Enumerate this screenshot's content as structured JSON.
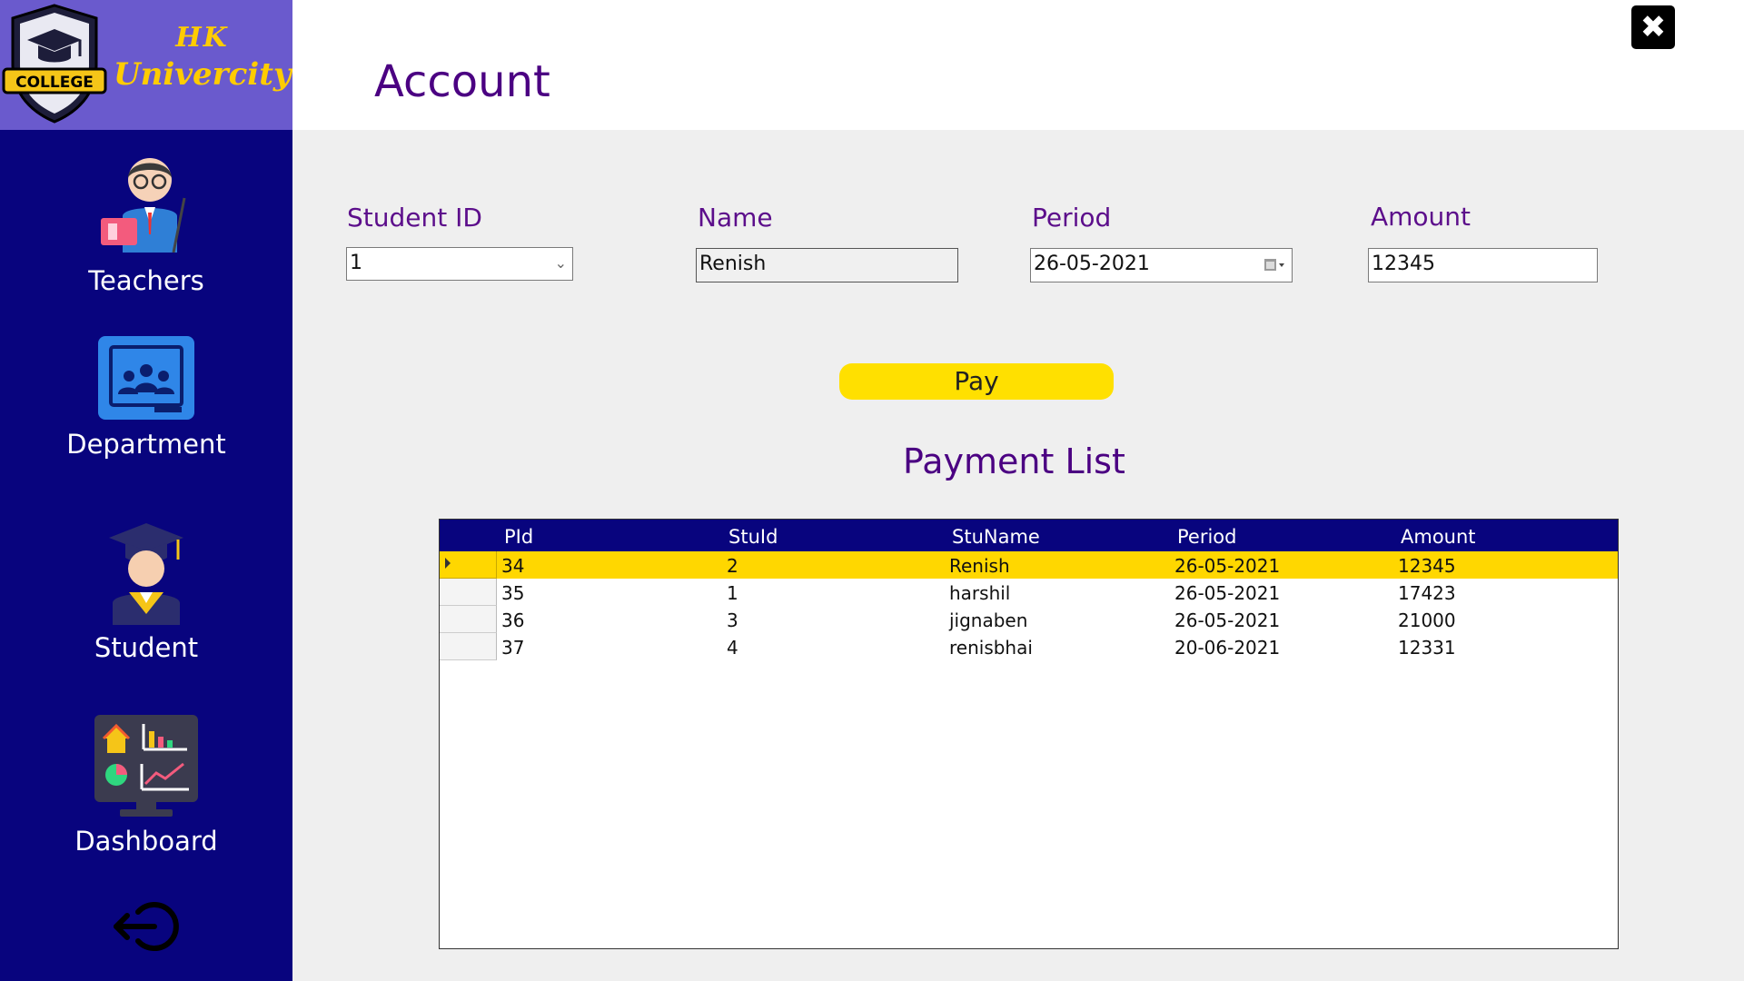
{
  "brand": {
    "badge_text": "COLLEGE",
    "line1": "HK",
    "line2": "Univercity"
  },
  "sidebar": {
    "items": [
      {
        "label": "Teachers",
        "icon": "teacher-icon"
      },
      {
        "label": "Department",
        "icon": "classroom-icon"
      },
      {
        "label": "Student",
        "icon": "graduate-student-icon"
      },
      {
        "label": "Dashboard",
        "icon": "dashboard-monitor-icon"
      }
    ],
    "logout_icon": "logout-icon"
  },
  "header": {
    "title": "Account",
    "close_icon": "close-icon"
  },
  "form": {
    "student_id": {
      "label": "Student ID",
      "value": "1"
    },
    "name": {
      "label": "Name",
      "value": "Renish"
    },
    "period": {
      "label": "Period",
      "value": "26-05-2021"
    },
    "amount": {
      "label": "Amount",
      "value": "12345"
    },
    "pay_label": "Pay"
  },
  "payment_list": {
    "title": "Payment List",
    "columns": [
      "PId",
      "StuId",
      "StuName",
      "Period",
      "Amount"
    ],
    "rows": [
      {
        "pid": "34",
        "stuid": "2",
        "stuname": "Renish",
        "period": "26-05-2021",
        "amount": "12345",
        "selected": true
      },
      {
        "pid": "35",
        "stuid": "1",
        "stuname": "harshil",
        "period": "26-05-2021",
        "amount": "17423",
        "selected": false
      },
      {
        "pid": "36",
        "stuid": "3",
        "stuname": "jignaben",
        "period": "26-05-2021",
        "amount": "21000",
        "selected": false
      },
      {
        "pid": "37",
        "stuid": "4",
        "stuname": "renisbhai",
        "period": "20-06-2021",
        "amount": "12331",
        "selected": false
      }
    ]
  },
  "colors": {
    "sidebar": "#08047e",
    "brand_bg": "#6a5acd",
    "accent_text": "#4b0082",
    "pay_button": "#ffe000",
    "selected_row": "#ffd700"
  }
}
